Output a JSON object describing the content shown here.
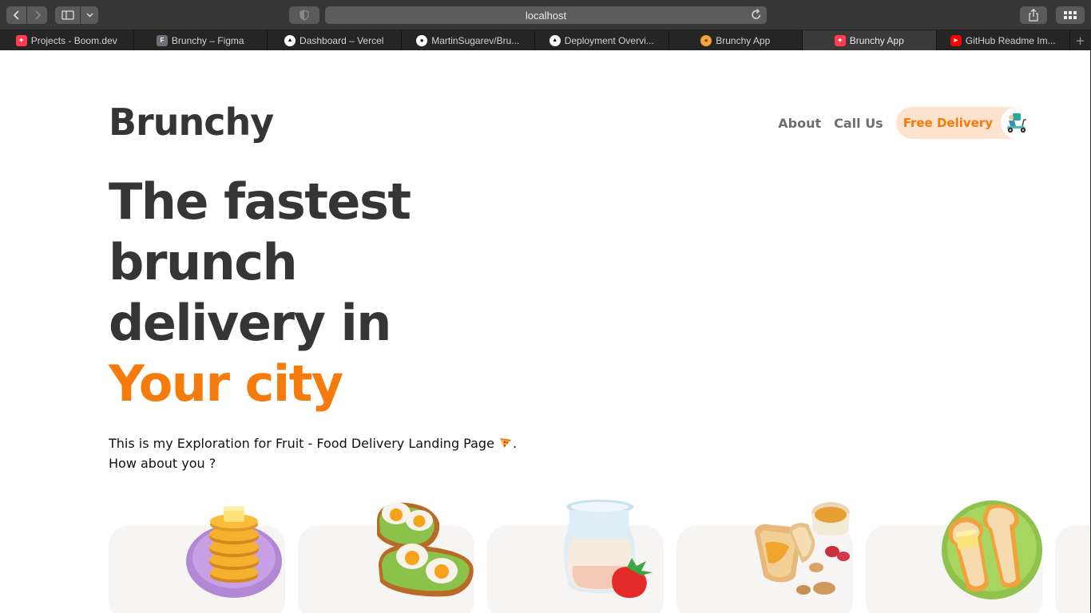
{
  "browser": {
    "url": "localhost",
    "tabs": [
      {
        "label": "Projects - Boom.dev",
        "favicon": "boom-icon"
      },
      {
        "label": "Brunchy – Figma",
        "favicon": "figma-icon"
      },
      {
        "label": "Dashboard – Vercel",
        "favicon": "vercel-icon"
      },
      {
        "label": "MartinSugarev/Bru...",
        "favicon": "github-icon"
      },
      {
        "label": "Deployment Overvi...",
        "favicon": "vercel-icon"
      },
      {
        "label": "Brunchy App",
        "favicon": "pancake-icon"
      },
      {
        "label": "Brunchy App",
        "favicon": "boom-icon",
        "active": true
      },
      {
        "label": "GitHub Readme Im...",
        "favicon": "youtube-icon"
      }
    ]
  },
  "site": {
    "logo": "Brunchy",
    "nav": {
      "about": "About",
      "call_us": "Call Us",
      "delivery": "Free Delivery"
    },
    "hero": {
      "line1": "The fastest",
      "line2": "brunch",
      "line3": "delivery in",
      "accent": "Your city"
    },
    "intro": {
      "line1": "This is my Exploration for Fruit - Food Delivery Landing Page",
      "line1_end": ".",
      "line2": "How about you ?"
    },
    "menu_items": [
      {
        "icon": "pancakes-icon"
      },
      {
        "icon": "avocado-toast-eggs-icon"
      },
      {
        "icon": "milk-strawberry-icon"
      },
      {
        "icon": "toast-peanut-butter-icon"
      },
      {
        "icon": "toast-butter-plate-icon"
      }
    ]
  },
  "colors": {
    "brand_text": "#353535",
    "accent": "#f57c0c",
    "pill_bg": "#fde3cd",
    "card_bg": "#f6f5f3"
  }
}
